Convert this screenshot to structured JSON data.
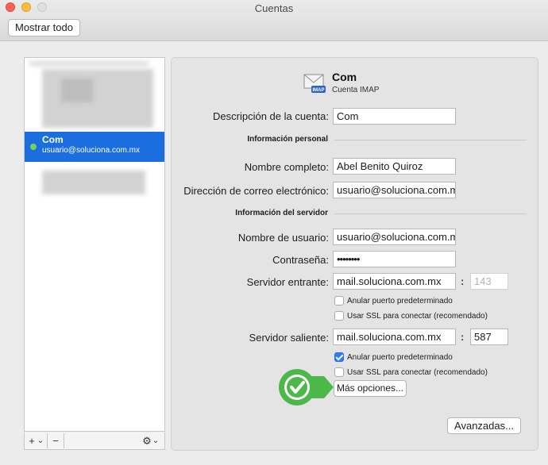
{
  "window": {
    "title": "Cuentas",
    "show_all": "Mostrar todo"
  },
  "sidebar": {
    "selected_account": {
      "name": "Com",
      "email": "usuario@soluciona.com.mx"
    },
    "add_label": "+",
    "add_menu_glyph": "⌄",
    "remove_label": "−",
    "gear_label": "⚙",
    "gear_menu_glyph": "⌄"
  },
  "header": {
    "name": "Com",
    "type": "Cuenta IMAP",
    "icon": "mail-envelope-icon",
    "badge": "IMAP"
  },
  "form": {
    "description_label": "Descripción de la cuenta:",
    "description_value": "Com",
    "personal_section": "Información personal",
    "fullname_label": "Nombre completo:",
    "fullname_value": "Abel Benito Quiroz",
    "email_label": "Dirección de correo electrónico:",
    "email_value": "usuario@soluciona.com.m",
    "server_section": "Información del servidor",
    "username_label": "Nombre de usuario:",
    "username_value": "usuario@soluciona.com.m",
    "password_label": "Contraseña:",
    "password_value": "••••••••",
    "incoming_label": "Servidor entrante:",
    "incoming_value": "mail.soluciona.com.mx",
    "incoming_port": "143",
    "incoming_override_label": "Anular puerto predeterminado",
    "incoming_override_checked": false,
    "incoming_ssl_label": "Usar SSL para conectar (recomendado)",
    "incoming_ssl_checked": false,
    "outgoing_label": "Servidor saliente:",
    "outgoing_value": "mail.soluciona.com.mx",
    "outgoing_port": "587",
    "outgoing_override_label": "Anular puerto predeterminado",
    "outgoing_override_checked": true,
    "outgoing_ssl_label": "Usar SSL para conectar (recomendado)",
    "outgoing_ssl_checked": false,
    "port_separator": ":",
    "more_options": "Más opciones...",
    "advanced": "Avanzadas..."
  },
  "colors": {
    "selection": "#1a6ee0",
    "checkbox_on": "#2f7df6",
    "badge_green": "#4cb849"
  }
}
